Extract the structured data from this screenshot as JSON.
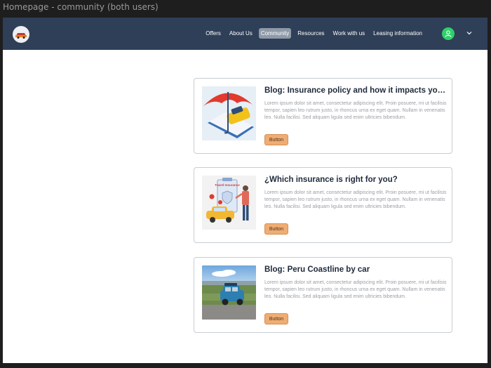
{
  "window": {
    "title": "Homepage - community (both users)"
  },
  "nav": {
    "links": [
      {
        "label": "Offers",
        "active": false
      },
      {
        "label": "About Us",
        "active": false
      },
      {
        "label": "Community",
        "active": true
      },
      {
        "label": "Resources",
        "active": false
      },
      {
        "label": "Work with us",
        "active": false
      },
      {
        "label": "Leasing information",
        "active": false
      }
    ],
    "avatar_icon": "user-icon",
    "menu_icon": "chevron-down-icon"
  },
  "cards": [
    {
      "title": "Blog: Insurance policy and how it impacts your...",
      "body": "Lorem ipsum dolor sit amet, consectetur adipiscing elit. Proin posuere, mi ut facilisis tempor, sapien leo rutrum justo, in rhoncus urna ex eget quam. Nullam in venenatis leo. Nulla facilisi. Sed aliquam ligula sed enim ultricies bibendum.",
      "button": "Button",
      "image": "umbrella-car-illustration"
    },
    {
      "title": "¿Which insurance is right for you?",
      "body": "Lorem ipsum dolor sit amet, consectetur adipiscing elit. Proin posuere, mi ut facilisis tempor, sapien leo rutrum justo, in rhoncus urna ex eget quam. Nullam in venenatis leo. Nulla facilisi. Sed aliquam ligula sed enim ultricies bibendum.",
      "button": "Button",
      "image": "travel-insurance-illustration",
      "image_text": "Travel Insurance"
    },
    {
      "title": "Blog: Peru Coastline by car",
      "body": "Lorem ipsum dolor sit amet, consectetur adipiscing elit. Proin posuere, mi ut facilisis tempor, sapien leo rutrum justo, in rhoncus urna ex eget quam. Nullam in venenatis leo. Nulla facilisi. Sed aliquam ligula sed enim ultricies bibendum.",
      "button": "Button",
      "image": "coastline-car-photo"
    }
  ],
  "colors": {
    "navbar": "#2e3f57",
    "accent_button": "#f0ad73",
    "avatar": "#2fd06a",
    "active_nav": "#8f9aa8"
  }
}
